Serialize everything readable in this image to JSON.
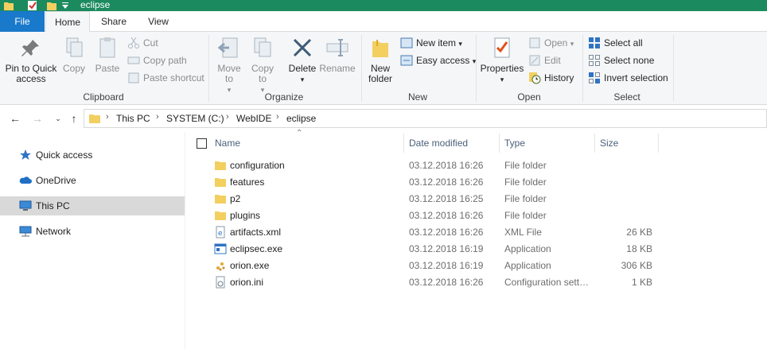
{
  "window": {
    "title": "eclipse"
  },
  "colors": {
    "titlebar": "#1b8a5e",
    "file_tab": "#1979ca",
    "selection": "#d9d9d9"
  },
  "tabs": [
    {
      "label": "File"
    },
    {
      "label": "Home"
    },
    {
      "label": "Share"
    },
    {
      "label": "View"
    }
  ],
  "ribbon": {
    "clipboard": {
      "label": "Clipboard",
      "pin": "Pin to Quick access",
      "copy": "Copy",
      "paste": "Paste",
      "cut": "Cut",
      "copy_path": "Copy path",
      "paste_shortcut": "Paste shortcut"
    },
    "organize": {
      "label": "Organize",
      "move_to": "Move to",
      "copy_to": "Copy to",
      "delete": "Delete",
      "rename": "Rename"
    },
    "new": {
      "label": "New",
      "new_folder": "New folder",
      "new_item": "New item",
      "easy_access": "Easy access"
    },
    "open": {
      "label": "Open",
      "properties": "Properties",
      "open": "Open",
      "edit": "Edit",
      "history": "History"
    },
    "select": {
      "label": "Select",
      "select_all": "Select all",
      "select_none": "Select none",
      "invert": "Invert selection"
    }
  },
  "address": {
    "crumbs": [
      "This PC",
      "SYSTEM (C:)",
      "WebIDE",
      "eclipse"
    ]
  },
  "navpane": {
    "items": [
      {
        "label": "Quick access",
        "icon": "star-icon"
      },
      {
        "label": "OneDrive",
        "icon": "cloud-icon"
      },
      {
        "label": "This PC",
        "icon": "computer-icon"
      },
      {
        "label": "Network",
        "icon": "network-icon"
      }
    ]
  },
  "columns": {
    "name": "Name",
    "date": "Date modified",
    "type": "Type",
    "size": "Size"
  },
  "files": [
    {
      "name": "configuration",
      "date": "03.12.2018 16:26",
      "type": "File folder",
      "size": "",
      "icon": "folder-icon"
    },
    {
      "name": "features",
      "date": "03.12.2018 16:26",
      "type": "File folder",
      "size": "",
      "icon": "folder-icon"
    },
    {
      "name": "p2",
      "date": "03.12.2018 16:25",
      "type": "File folder",
      "size": "",
      "icon": "folder-icon"
    },
    {
      "name": "plugins",
      "date": "03.12.2018 16:26",
      "type": "File folder",
      "size": "",
      "icon": "folder-icon"
    },
    {
      "name": "artifacts.xml",
      "date": "03.12.2018 16:26",
      "type": "XML File",
      "size": "26 KB",
      "icon": "xml-file-icon"
    },
    {
      "name": "eclipsec.exe",
      "date": "03.12.2018 16:19",
      "type": "Application",
      "size": "18 KB",
      "icon": "exe-icon"
    },
    {
      "name": "orion.exe",
      "date": "03.12.2018 16:19",
      "type": "Application",
      "size": "306 KB",
      "icon": "orion-exe-icon"
    },
    {
      "name": "orion.ini",
      "date": "03.12.2018 16:26",
      "type": "Configuration sett…",
      "size": "1 KB",
      "icon": "ini-file-icon"
    }
  ]
}
